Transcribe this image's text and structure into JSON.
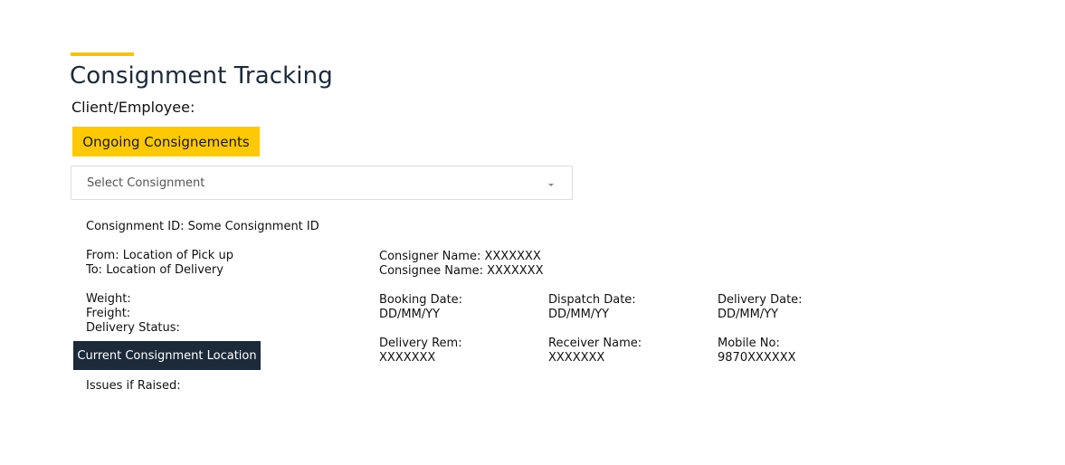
{
  "header": {
    "title": "Consignment Tracking",
    "client_label": "Client/Employee:"
  },
  "actions": {
    "ongoing_label": "Ongoing Consignements",
    "location_label": "Current Consignment Location"
  },
  "select": {
    "placeholder": "Select Consignment"
  },
  "details": {
    "consignment_id": "Consignment ID: Some Consignment ID",
    "from": "From: Location of Pick up",
    "to": "To: Location of Delivery",
    "weight": "Weight:",
    "freight": "Freight:",
    "delivery_status": "Delivery Status:",
    "issues": "Issues if Raised:",
    "consigner_name": "Consigner Name: XXXXXXX",
    "consignee_name": "Consignee Name: XXXXXXX",
    "booking_date_label": "Booking Date:",
    "booking_date_value": "DD/MM/YY",
    "dispatch_date_label": "Dispatch Date:",
    "dispatch_date_value": "DD/MM/YY",
    "delivery_date_label": "Delivery Date:",
    "delivery_date_value": "DD/MM/YY",
    "delivery_rem_label": "Delivery Rem:",
    "delivery_rem_value": "XXXXXXX",
    "receiver_name_label": "Receiver Name:",
    "receiver_name_value": "XXXXXXX",
    "mobile_label": "Mobile No:",
    "mobile_value": "9870XXXXXX"
  },
  "colors": {
    "accent": "#ffc805",
    "dark": "#1c2a3a"
  }
}
